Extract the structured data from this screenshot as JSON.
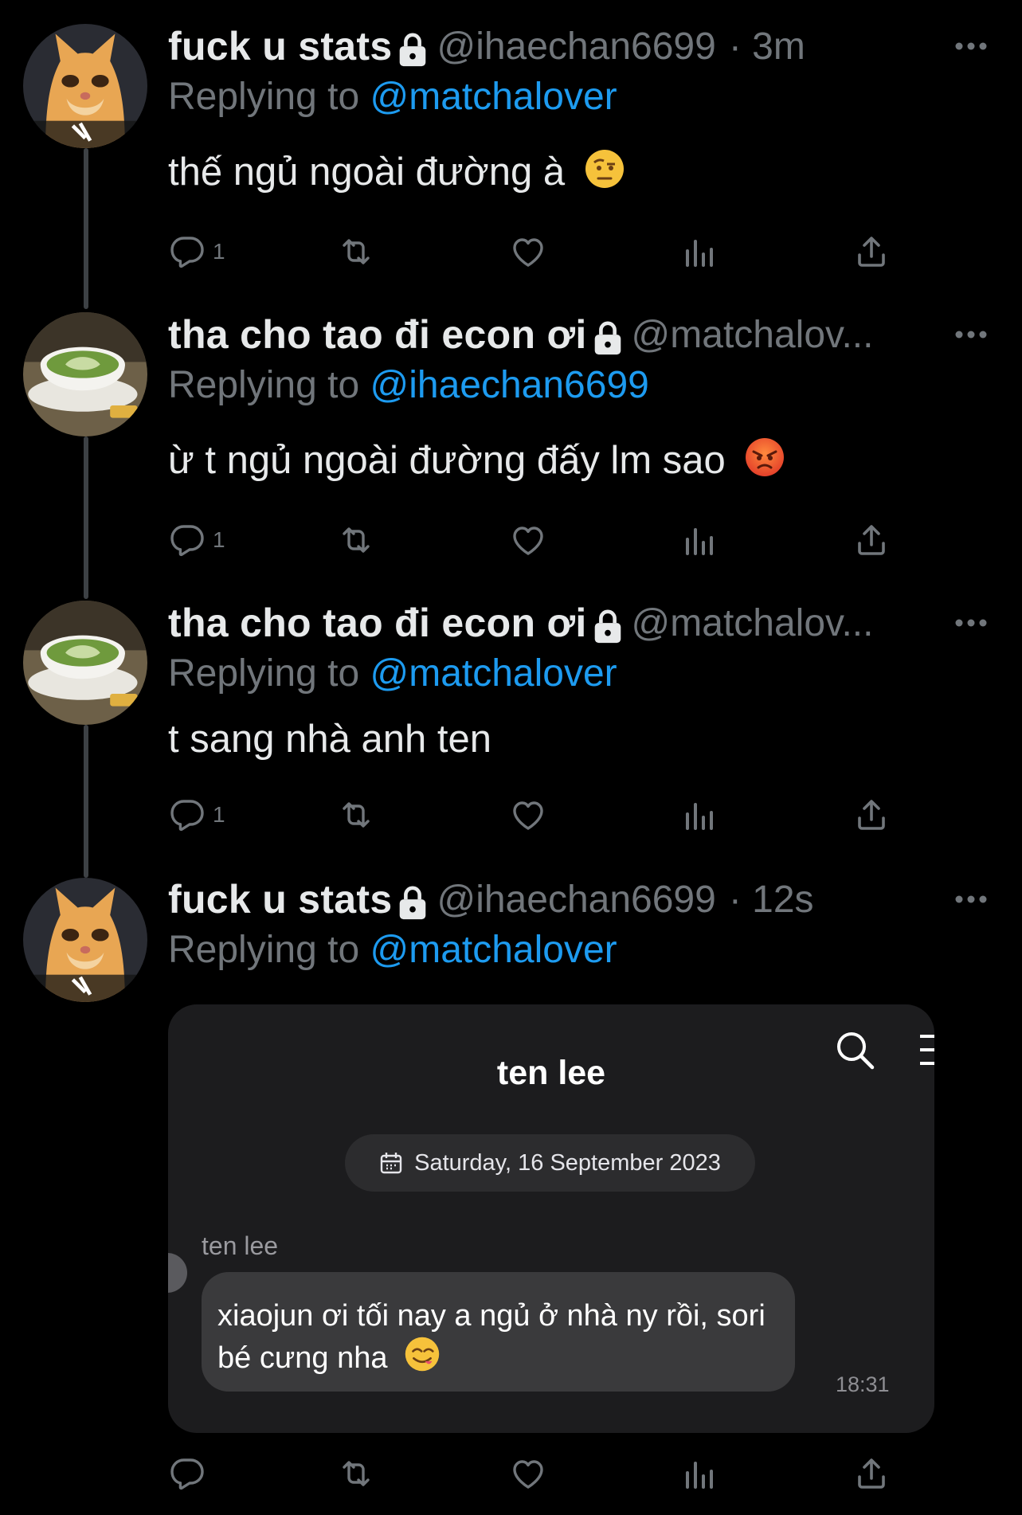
{
  "tweets": [
    {
      "display_name": "fuck u stats",
      "handle": "@ihaechan6699",
      "time": "· 3m",
      "replying_prefix": "Replying to",
      "replying_to": "@matchalover",
      "text": "thế ngủ ngoài đường à",
      "emoji": "raised-eyebrow-emoji",
      "reply_count": "1"
    },
    {
      "display_name": "tha cho tao đi econ ơi",
      "handle": "@matchalov...",
      "time": "",
      "replying_prefix": "Replying to",
      "replying_to": "@ihaechan6699",
      "text": "ừ t ngủ ngoài đường đấy lm sao",
      "emoji": "angry-face-emoji",
      "reply_count": "1"
    },
    {
      "display_name": "tha cho tao đi econ ơi",
      "handle": "@matchalov...",
      "time": "",
      "replying_prefix": "Replying to",
      "replying_to": "@matchalover",
      "text": "t sang nhà anh ten",
      "emoji": "",
      "reply_count": "1"
    },
    {
      "display_name": "fuck u stats",
      "handle": "@ihaechan6699",
      "time": "· 12s",
      "replying_prefix": "Replying to",
      "replying_to": "@matchalover",
      "text": "",
      "emoji": "",
      "reply_count": ""
    }
  ],
  "chat_screenshot": {
    "title": "ten lee",
    "date": "Saturday, 16 September 2023",
    "sender": "ten lee",
    "message_line1": "xiaojun ơi tối nay a ngủ ở nhà ny rồi, sori",
    "message_line2": "bé cưng nha",
    "message_emoji": "yum-face-emoji",
    "time": "18:31"
  },
  "colors": {
    "background": "#000000",
    "text": "#e7e9ea",
    "muted": "#71767b",
    "accent": "#1d9bf0",
    "chat_card": "#1c1c1e",
    "bubble": "#3a3a3c"
  },
  "icons": [
    "lock-icon",
    "more-icon",
    "reply-icon",
    "retweet-icon",
    "like-icon",
    "views-icon",
    "share-icon",
    "search-icon",
    "calendar-icon"
  ]
}
